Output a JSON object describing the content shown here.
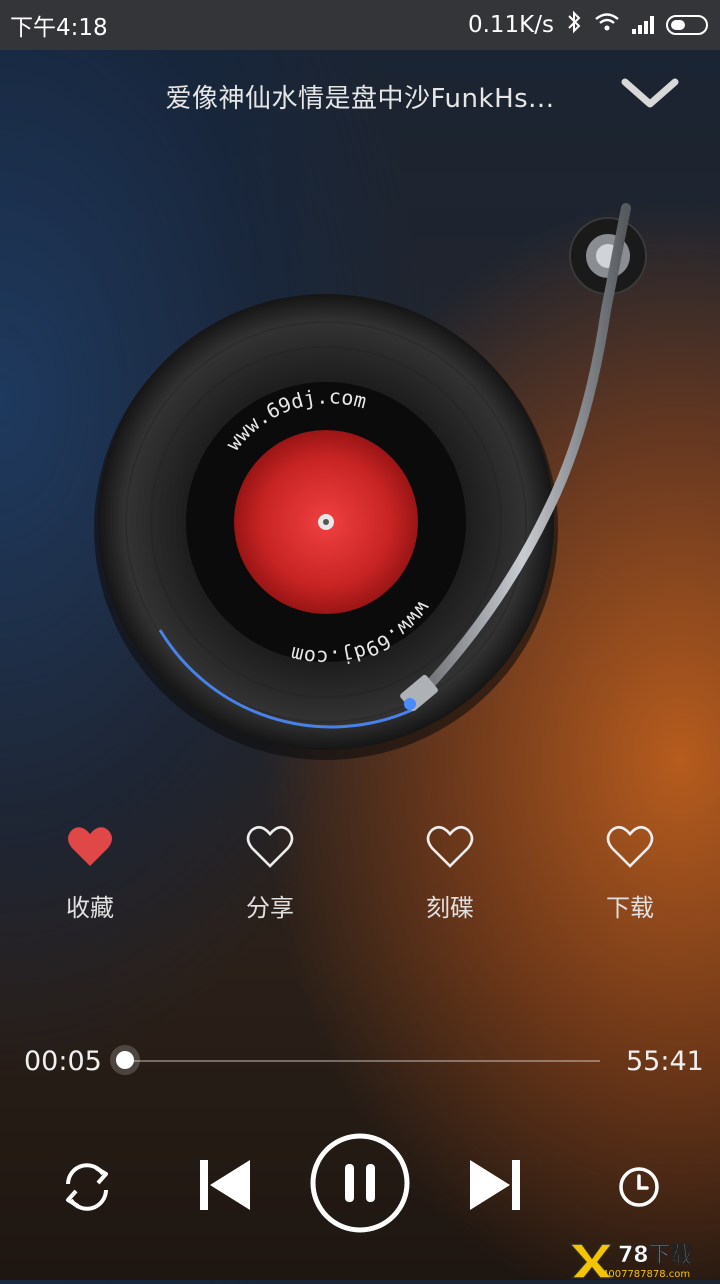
{
  "status_bar": {
    "time": "下午4:18",
    "speed": "0.11K/s",
    "bluetooth_icon": "bluetooth-icon",
    "wifi_icon": "wifi-icon",
    "signal_icon": "signal-icon",
    "battery_icon": "battery-icon"
  },
  "header": {
    "title": "爱像神仙水情是盘中沙FunkHs...",
    "collapse_icon": "chevron-down-icon"
  },
  "record": {
    "label_text": "www.69dj.com",
    "label_color": "#d42a2a",
    "glow_color": "#4a8cff"
  },
  "actions": [
    {
      "label": "收藏",
      "icon": "heart-filled-icon",
      "active": true,
      "color": "#e04848"
    },
    {
      "label": "分享",
      "icon": "heart-outline-icon",
      "active": false
    },
    {
      "label": "刻碟",
      "icon": "heart-outline-icon",
      "active": false
    },
    {
      "label": "下载",
      "icon": "heart-outline-icon",
      "active": false
    }
  ],
  "progress": {
    "current": "00:05",
    "total": "55:41",
    "fraction": 0.002
  },
  "controls": {
    "repeat_icon": "repeat-icon",
    "prev_icon": "previous-icon",
    "pause_icon": "pause-icon",
    "next_icon": "next-icon",
    "timer_icon": "timer-icon"
  },
  "watermark": {
    "brand": "78下载",
    "phone": "4007787878.com",
    "logo_icon": "x-logo-icon",
    "logo_color": "#f5c400"
  }
}
